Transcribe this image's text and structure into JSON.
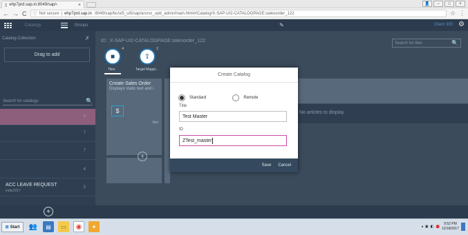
{
  "browser": {
    "tab_title": "ehp7prd.sap.in:8049/sap/‹",
    "not_secure": "Not secure",
    "url_host": "ehp7prd.sap.in",
    "url_path": ":8049/sap/bc/ui5_ui5/sap/arsrvc_upb_admn/main.html#/Catalog/X-SAP-UI2-CATALOGPAGE:salesorder_122"
  },
  "shell": {
    "catalog_label": "Catalogs",
    "groups_label": "Groups",
    "client_label": "Client 300"
  },
  "left_panel": {
    "title": "Catalog Collection",
    "drag_to_add": "Drag to add",
    "search_placeholder": "Search for catalogs",
    "rows": [
      {
        "count": "6"
      },
      {
        "count": "7"
      },
      {
        "count": "7"
      },
      {
        "count": "4"
      },
      {
        "name": "ACC LEAVE REQUEST",
        "sub": "indie2017",
        "count": "2"
      }
    ]
  },
  "main": {
    "breadcrumb": "ID : X-SAP-UI2-CATALOGPAGE:salesorder_122",
    "search_placeholder": "Search for tiles",
    "tabs": [
      {
        "label": "Tiles",
        "badge": "4"
      },
      {
        "label": "Target Mappi...",
        "badge": "2"
      }
    ],
    "tile": {
      "title": "Create Sales Order",
      "subtitle": "Displays static text and i"
    },
    "tile_footer": "fiori",
    "no_articles": "No articles to display"
  },
  "dialog": {
    "title": "Create Catalog",
    "radio_standard": "Standard",
    "radio_remote": "Remote",
    "title_label": "Title",
    "title_value": "Test Master",
    "id_label": "ID",
    "id_value": "ZTest_master",
    "save": "Save",
    "cancel": "Cancel"
  },
  "taskbar": {
    "start": "Start",
    "time": "9:52 PM",
    "date": "12/18/2017"
  }
}
